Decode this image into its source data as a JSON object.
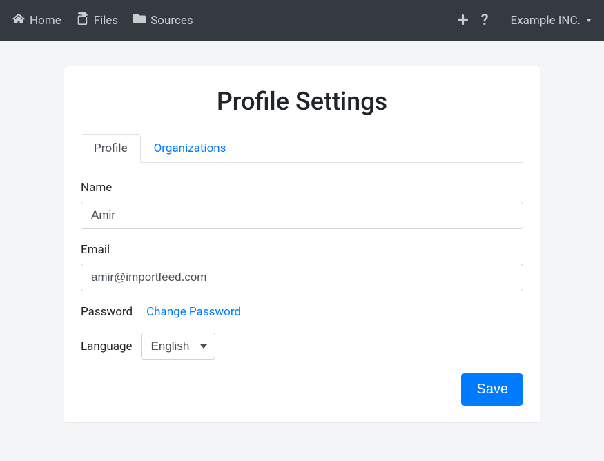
{
  "nav": {
    "home": "Home",
    "files": "Files",
    "sources": "Sources",
    "org_name": "Example INC."
  },
  "page": {
    "title": "Profile Settings"
  },
  "tabs": {
    "profile": "Profile",
    "organizations": "Organizations"
  },
  "form": {
    "name_label": "Name",
    "name_value": "Amir",
    "email_label": "Email",
    "email_value": "amir@importfeed.com",
    "password_label": "Password",
    "change_password": "Change Password",
    "language_label": "Language",
    "language_value": "English",
    "save": "Save"
  }
}
